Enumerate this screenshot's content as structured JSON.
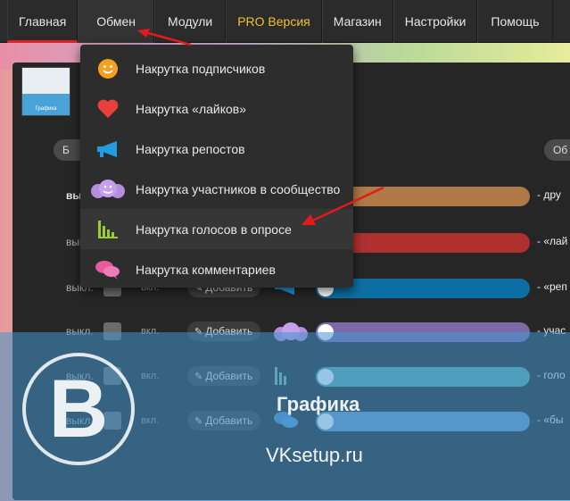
{
  "nav": {
    "items": [
      {
        "label": "Главная"
      },
      {
        "label": "Обмен"
      },
      {
        "label": "Модули"
      },
      {
        "label": "PRO Версия"
      },
      {
        "label": "Магазин"
      },
      {
        "label": "Настройки"
      },
      {
        "label": "Помощь"
      }
    ]
  },
  "dropdown": {
    "items": [
      {
        "label": "Накрутка подписчиков",
        "icon": "smiley-icon"
      },
      {
        "label": "Накрутка «лайков»",
        "icon": "heart-icon"
      },
      {
        "label": "Накрутка репостов",
        "icon": "megaphone-icon"
      },
      {
        "label": "Накрутка участников в сообщество",
        "icon": "group-icon"
      },
      {
        "label": "Накрутка голосов в опросе",
        "icon": "poll-chart-icon"
      },
      {
        "label": "Накрутка комментариев",
        "icon": "comments-icon"
      }
    ]
  },
  "panel": {
    "thumb_caption": "Графика",
    "pill_left": "Б",
    "pill_right": "Об"
  },
  "rows": [
    {
      "off": "выкл.",
      "on": "",
      "add": "",
      "text": "- дру",
      "color": "#b07a48"
    },
    {
      "off": "выкл.",
      "on": "",
      "add": "",
      "text": "- «лай",
      "color": "#b03030"
    },
    {
      "off": "выкл.",
      "on": "вкл.",
      "add": "Добавить",
      "text": "- «реп",
      "color": "#0d6ea3"
    },
    {
      "off": "выкл.",
      "on": "вкл.",
      "add": "Добавить",
      "text": "- учас",
      "color": "#7b6aa8"
    },
    {
      "off": "выкл.",
      "on": "вкл.",
      "add": "Добавить",
      "text": "- голо",
      "color": "#5aa6a6"
    },
    {
      "off": "выкл.",
      "on": "вкл.",
      "add": "Добавить",
      "text": "- «бы",
      "color": "#6a97c4"
    }
  ],
  "watermark": {
    "letter": "B",
    "title": "Графика",
    "site": "VKsetup.ru"
  }
}
